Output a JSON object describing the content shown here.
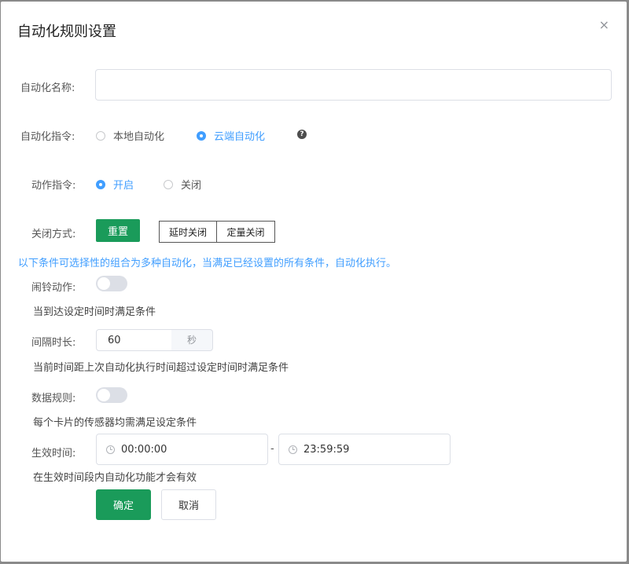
{
  "dialog": {
    "title": "自动化规则设置",
    "close_glyph": "×"
  },
  "fields": {
    "name": {
      "label": "自动化名称:",
      "value": "",
      "placeholder": ""
    },
    "command": {
      "label": "自动化指令:",
      "options": [
        {
          "label": "本地自动化",
          "checked": false
        },
        {
          "label": "云端自动化",
          "checked": true
        }
      ],
      "help_icon": "?"
    },
    "action": {
      "label": "动作指令:",
      "options": [
        {
          "label": "开启",
          "checked": true
        },
        {
          "label": "关闭",
          "checked": false
        }
      ]
    },
    "close_mode": {
      "label": "关闭方式:",
      "reset_button": "重置",
      "delay_button": "延时关闭",
      "quantity_button": "定量关闭"
    }
  },
  "info_text": "以下条件可选择性的组合为多种自动化，当满足已经设置的所有条件，自动化执行。",
  "conditions": {
    "alarm": {
      "label": "闹铃动作:",
      "enabled": false,
      "note": "当到达设定时间时满足条件"
    },
    "interval": {
      "label": "间隔时长:",
      "value": "60",
      "unit": "秒",
      "note": "当前时间距上次自动化执行时间超过设定时间时满足条件"
    },
    "data_rule": {
      "label": "数据规则:",
      "enabled": false,
      "note": "每个卡片的传感器均需满足设定条件"
    },
    "effective": {
      "label": "生效时间:",
      "start": "00:00:00",
      "separator": "-",
      "end": "23:59:59",
      "note": "在生效时间段内自动化功能才会有效"
    }
  },
  "footer": {
    "confirm": "确定",
    "cancel": "取消"
  },
  "colors": {
    "primary_green": "#1a9b5a",
    "accent_blue": "#409eff"
  }
}
